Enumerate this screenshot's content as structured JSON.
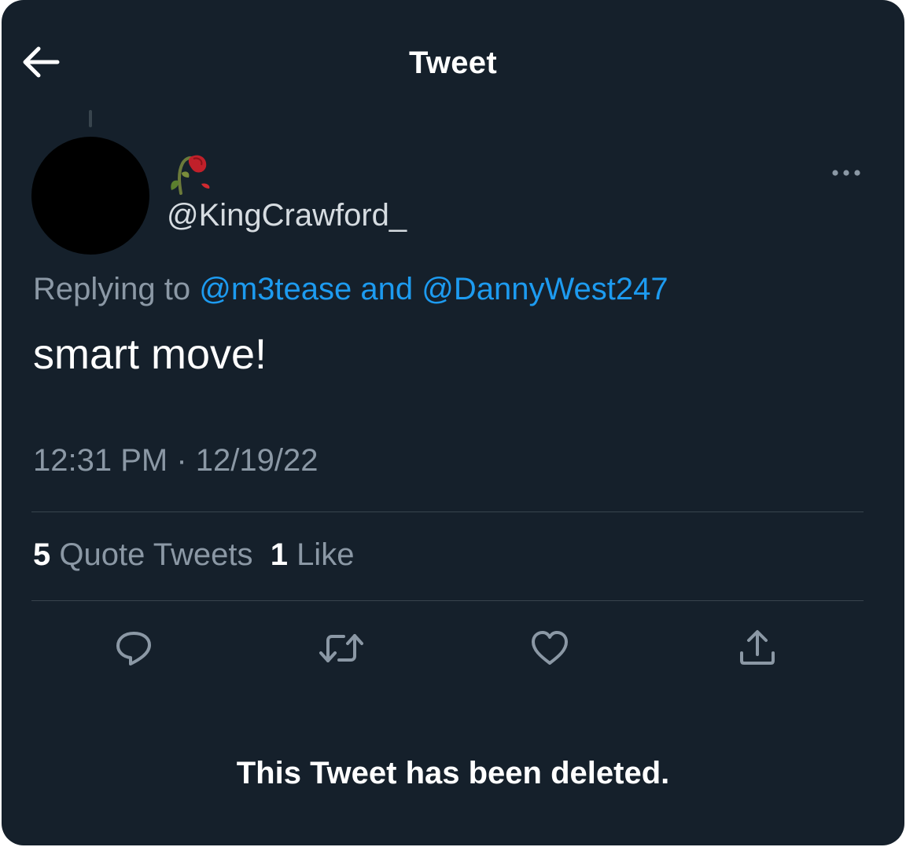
{
  "header": {
    "title": "Tweet",
    "back_icon": "arrow-left-icon"
  },
  "tweet": {
    "display_name_icon": "wilted-rose-emoji",
    "handle": "@KingCrawford_",
    "more_icon": "more-horizontal-icon",
    "replying_prefix": "Replying to ",
    "replying_user_1": "@m3tease",
    "replying_joiner": " and ",
    "replying_user_2": "@DannyWest247",
    "text": "smart move!",
    "timestamp": "12:31 PM · 12/19/22",
    "stats": {
      "quote_count": "5",
      "quote_label": "Quote Tweets",
      "like_count": "1",
      "like_label": "Like"
    },
    "actions": [
      {
        "name": "reply",
        "icon": "reply-icon"
      },
      {
        "name": "retweet",
        "icon": "retweet-icon"
      },
      {
        "name": "like",
        "icon": "heart-icon"
      },
      {
        "name": "share",
        "icon": "share-icon"
      }
    ]
  },
  "deleted_notice": "This Tweet has been deleted.",
  "colors": {
    "background": "#15202b",
    "link": "#1d9bf0",
    "secondary_text": "#8b98a5",
    "divider": "#38444d"
  }
}
